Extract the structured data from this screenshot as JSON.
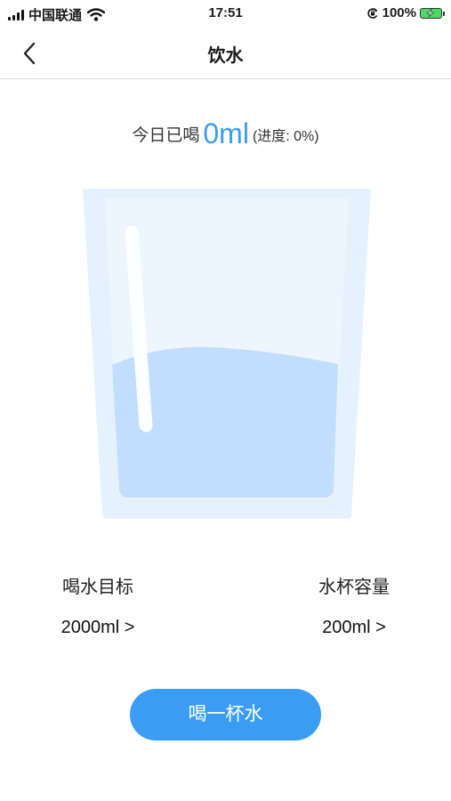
{
  "status_bar": {
    "carrier": "中国联通",
    "time": "17:51",
    "battery_percent": "100%",
    "icons": [
      "signal-icon",
      "wifi-icon",
      "orientation-lock-icon",
      "battery-charging-icon"
    ]
  },
  "nav": {
    "title": "饮水",
    "back_icon": "chevron-left-icon"
  },
  "today": {
    "label": "今日已喝",
    "amount": "0ml",
    "progress_text": "(进度: 0%)",
    "progress_value": 0
  },
  "glass": {
    "icon": "water-glass-illustration",
    "water_color": "#c2deff",
    "glass_color": "#e6f1fe"
  },
  "stats": {
    "goal": {
      "label": "喝水目标",
      "value": "2000ml >"
    },
    "cup": {
      "label": "水杯容量",
      "value": "200ml >"
    }
  },
  "action": {
    "label": "喝一杯水",
    "color": "#3a9df3"
  },
  "accent_color": "#3a9cf0"
}
